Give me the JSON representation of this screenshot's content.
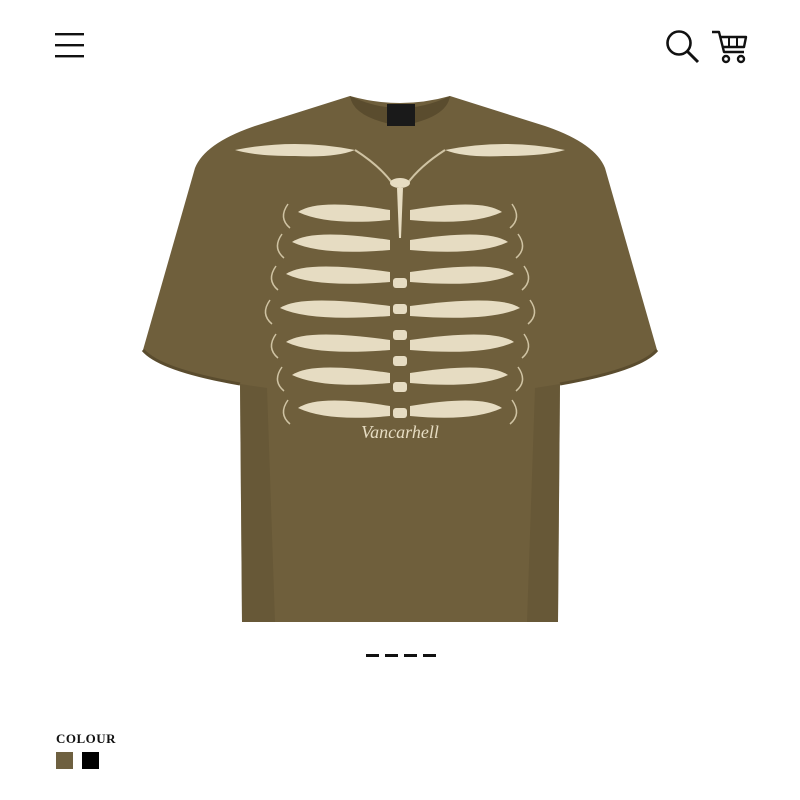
{
  "header": {
    "menu_icon": "hamburger-menu-icon",
    "search_icon": "search-icon",
    "cart_icon": "cart-icon"
  },
  "product": {
    "image_alt": "Brown oversized t-shirt with cream skeleton ribcage appliqué",
    "brand_print": "Vancarhell",
    "shirt_color": "#6f5f3c",
    "bone_color": "#e6dcc2"
  },
  "carousel": {
    "indicator_count": 4,
    "active_index": 0
  },
  "colour": {
    "label": "COLOUR",
    "options": [
      {
        "name": "brown",
        "hex": "#6e6040"
      },
      {
        "name": "black",
        "hex": "#000000"
      }
    ]
  }
}
